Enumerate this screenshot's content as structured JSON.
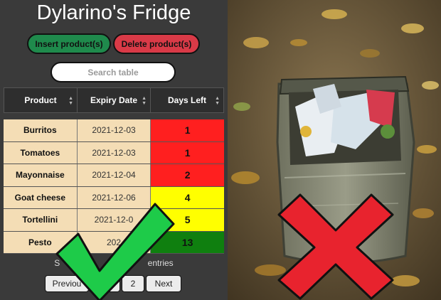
{
  "app": {
    "title": "Dylarino's Fridge",
    "insert_label": "Insert product(s)",
    "delete_label": "Delete product(s)",
    "search_placeholder": "Search table"
  },
  "table": {
    "headers": [
      "Product",
      "Expiry Date",
      "Days Left"
    ],
    "rows": [
      {
        "product": "Burritos",
        "date": "2021-12-03",
        "days": "1",
        "color": "#ff1f1f"
      },
      {
        "product": "Tomatoes",
        "date": "2021-12-03",
        "days": "1",
        "color": "#ff1f1f"
      },
      {
        "product": "Mayonnaise",
        "date": "2021-12-04",
        "days": "2",
        "color": "#ff1f1f"
      },
      {
        "product": "Goat cheese",
        "date": "2021-12-06",
        "days": "4",
        "color": "#ffff00"
      },
      {
        "product": "Tortellini",
        "date": "2021-12-0",
        "days": "5",
        "color": "#ffff00"
      },
      {
        "product": "Pesto",
        "date": "202",
        "days": "13",
        "color": "#0f7f0f"
      }
    ]
  },
  "footer": {
    "entries_left": "S",
    "entries_right": "entries"
  },
  "pager": {
    "previous": "Previou",
    "page1": "1",
    "page2": "2",
    "next": "Next"
  },
  "overlays": {
    "check_color": "#1ecb49",
    "cross_color": "#e8232e"
  }
}
